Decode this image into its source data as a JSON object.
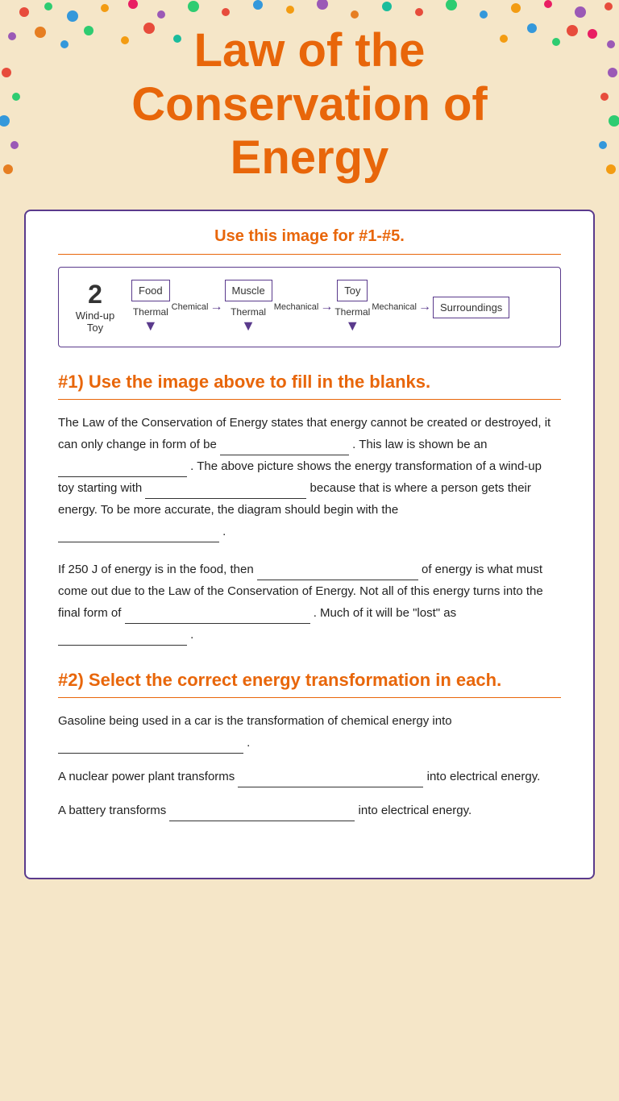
{
  "header": {
    "title_line1": "Law of the",
    "title_line2": "Conservation of",
    "title_line3": "Energy"
  },
  "diagram_section": {
    "instruction": "Use this image for #1-#5.",
    "diagram": {
      "number": "2",
      "label": "Wind-up\nToy",
      "nodes": [
        {
          "name": "Food",
          "energy_out": "Chemical"
        },
        {
          "name": "Muscle",
          "energy_out": "Mechanical"
        },
        {
          "name": "Toy",
          "energy_out": "Mechanical"
        },
        {
          "name": "Surroundings"
        }
      ],
      "thermal_labels": [
        "Thermal",
        "Thermal",
        "Thermal"
      ]
    }
  },
  "question1": {
    "title": "#1) Use the image above to fill in the blanks.",
    "paragraphs": [
      "The Law of the Conservation of Energy states that energy cannot be created or destroyed, it can only change in form of be __________________ . This law is shown be an __________________ . The above picture shows the energy transformation of a wind-up toy starting with __________________ because that is where a person gets their energy. To be more accurate, the diagram should begin with the __________________ .",
      "If 250 J of energy is in the food, then __________________ of energy is what must come out due to the Law of the Conservation of Energy. Not all of this energy turns into the final form of __________________ . Much of it will be \"lost\" as __________________ ."
    ]
  },
  "question2": {
    "title": "#2) Select the correct energy transformation in each.",
    "paragraphs": [
      "Gasoline being used in a car is the transformation of chemical energy into __________________ .",
      "A nuclear power plant transforms __________________ into electrical energy.",
      "A battery transforms __________________ into electrical energy."
    ]
  },
  "dots": {
    "colors": [
      "#e74c3c",
      "#2ecc71",
      "#3498db",
      "#f39c12",
      "#9b59b6",
      "#e67e22",
      "#1abc9c",
      "#e91e63",
      "#795548",
      "#ff5722"
    ]
  }
}
